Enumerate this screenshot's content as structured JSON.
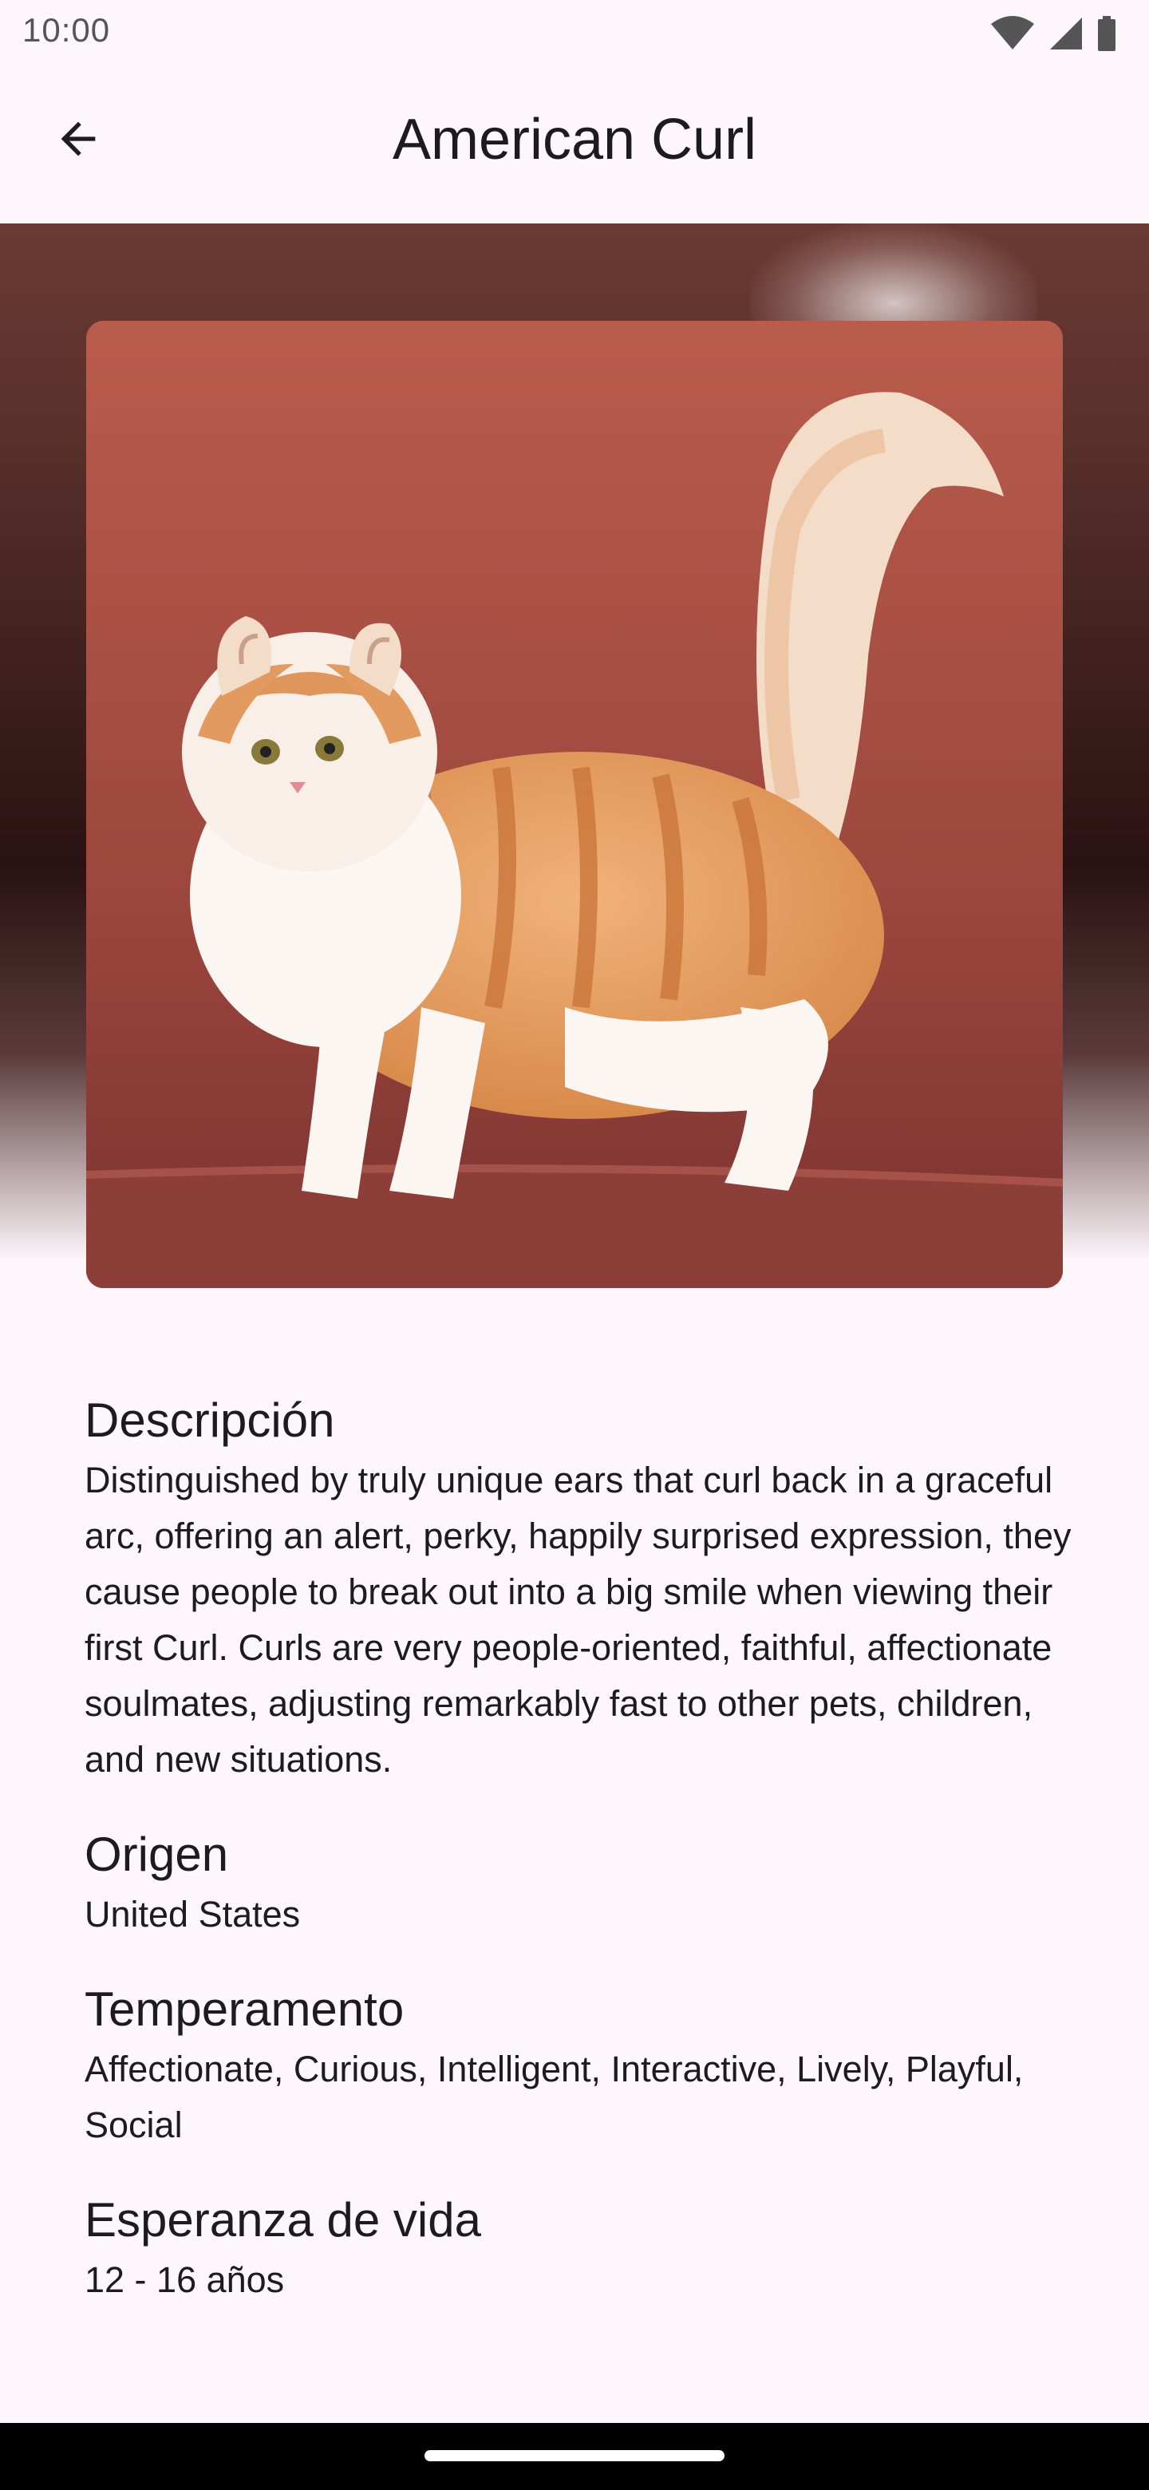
{
  "status_bar": {
    "time": "10:00",
    "icons": [
      "wifi-icon",
      "cellular-signal-icon",
      "battery-icon"
    ]
  },
  "app_bar": {
    "title": "American Curl",
    "back_icon": "arrow-back-icon"
  },
  "hero": {
    "image_description": "orange-and-white-curly-eared-cat"
  },
  "sections": {
    "description": {
      "heading": "Descripción",
      "body": "Distinguished by truly unique ears that curl back in a graceful arc, offering an alert, perky, happily surprised expression, they cause people to break out into a big smile when viewing their first Curl. Curls are very people-oriented, faithful, affectionate soulmates, adjusting remarkably fast to other pets, children, and new situations."
    },
    "origin": {
      "heading": "Origen",
      "body": "United States"
    },
    "temperament": {
      "heading": "Temperamento",
      "body": "Affectionate, Curious, Intelligent, Interactive, Lively, Playful, Social"
    },
    "life_span": {
      "heading": "Esperanza de vida",
      "body": "12 - 16 años"
    }
  },
  "colors": {
    "background": "#fdf7fb",
    "text": "#1c1b1f",
    "hero_dark": "#2a1212",
    "image_backdrop": "#a04a40"
  }
}
